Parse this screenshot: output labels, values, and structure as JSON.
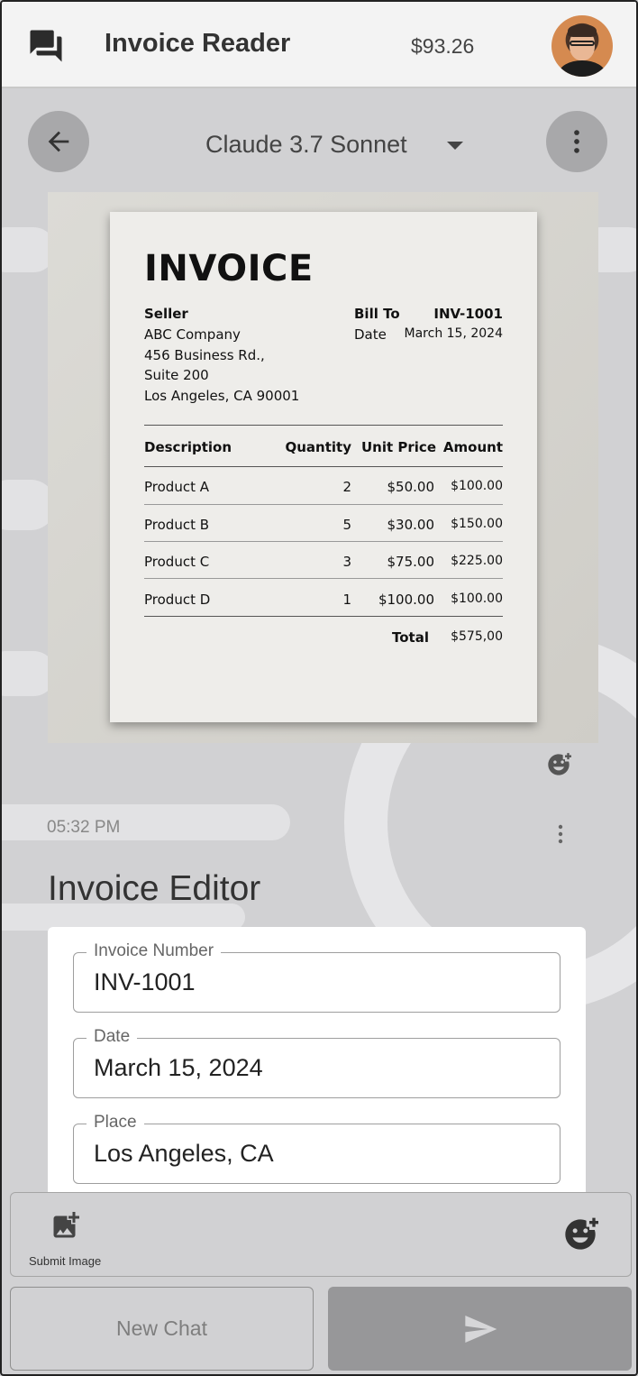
{
  "app": {
    "title": "Invoice Reader",
    "balance": "$93.26"
  },
  "model": {
    "selected": "Claude 3.7 Sonnet"
  },
  "invoice_image": {
    "heading": "INVOICE",
    "seller_label": "Seller",
    "seller_lines": [
      "ABC Company",
      "456 Business Rd.,",
      "Suite 200",
      "Los Angeles, CA 90001"
    ],
    "bill_to_label": "Bill To",
    "invoice_no": "INV-1001",
    "date_label": "Date",
    "date_value": "March 15, 2024",
    "columns": [
      "Description",
      "Quantity",
      "Unit Price",
      "Amount"
    ],
    "rows": [
      [
        "Product A",
        "2",
        "$50.00",
        "$100.00"
      ],
      [
        "Product B",
        "5",
        "$30.00",
        "$150.00"
      ],
      [
        "Product C",
        "3",
        "$75.00",
        "$225.00"
      ],
      [
        "Product D",
        "1",
        "$100.00",
        "$100.00"
      ]
    ],
    "total_label": "Total",
    "total_value": "$575,00"
  },
  "message": {
    "timestamp": "05:32 PM"
  },
  "editor": {
    "title": "Invoice Editor",
    "fields": [
      {
        "label": "Invoice Number",
        "value": "INV-1001"
      },
      {
        "label": "Date",
        "value": "March 15, 2024"
      },
      {
        "label": "Place",
        "value": "Los Angeles, CA"
      }
    ]
  },
  "composer": {
    "submit_image_label": "Submit Image",
    "new_chat_label": "New Chat"
  },
  "icons": {
    "chat": "forum-icon",
    "back": "arrow-back-icon",
    "more": "more-vert-icon",
    "emoji": "add-reaction-icon",
    "image": "add-photo-icon",
    "send": "send-icon"
  },
  "colors": {
    "appbar_bg": "#f3f3f3",
    "page_bg": "#d1d1d3",
    "send_bg": "#979799"
  }
}
